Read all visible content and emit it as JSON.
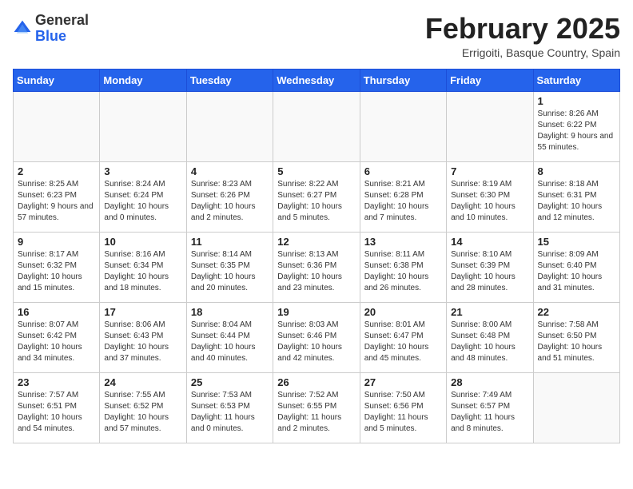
{
  "header": {
    "logo_general": "General",
    "logo_blue": "Blue",
    "title": "February 2025",
    "subtitle": "Errigoiti, Basque Country, Spain"
  },
  "weekdays": [
    "Sunday",
    "Monday",
    "Tuesday",
    "Wednesday",
    "Thursday",
    "Friday",
    "Saturday"
  ],
  "weeks": [
    [
      {
        "day": "",
        "info": ""
      },
      {
        "day": "",
        "info": ""
      },
      {
        "day": "",
        "info": ""
      },
      {
        "day": "",
        "info": ""
      },
      {
        "day": "",
        "info": ""
      },
      {
        "day": "",
        "info": ""
      },
      {
        "day": "1",
        "info": "Sunrise: 8:26 AM\nSunset: 6:22 PM\nDaylight: 9 hours and 55 minutes."
      }
    ],
    [
      {
        "day": "2",
        "info": "Sunrise: 8:25 AM\nSunset: 6:23 PM\nDaylight: 9 hours and 57 minutes."
      },
      {
        "day": "3",
        "info": "Sunrise: 8:24 AM\nSunset: 6:24 PM\nDaylight: 10 hours and 0 minutes."
      },
      {
        "day": "4",
        "info": "Sunrise: 8:23 AM\nSunset: 6:26 PM\nDaylight: 10 hours and 2 minutes."
      },
      {
        "day": "5",
        "info": "Sunrise: 8:22 AM\nSunset: 6:27 PM\nDaylight: 10 hours and 5 minutes."
      },
      {
        "day": "6",
        "info": "Sunrise: 8:21 AM\nSunset: 6:28 PM\nDaylight: 10 hours and 7 minutes."
      },
      {
        "day": "7",
        "info": "Sunrise: 8:19 AM\nSunset: 6:30 PM\nDaylight: 10 hours and 10 minutes."
      },
      {
        "day": "8",
        "info": "Sunrise: 8:18 AM\nSunset: 6:31 PM\nDaylight: 10 hours and 12 minutes."
      }
    ],
    [
      {
        "day": "9",
        "info": "Sunrise: 8:17 AM\nSunset: 6:32 PM\nDaylight: 10 hours and 15 minutes."
      },
      {
        "day": "10",
        "info": "Sunrise: 8:16 AM\nSunset: 6:34 PM\nDaylight: 10 hours and 18 minutes."
      },
      {
        "day": "11",
        "info": "Sunrise: 8:14 AM\nSunset: 6:35 PM\nDaylight: 10 hours and 20 minutes."
      },
      {
        "day": "12",
        "info": "Sunrise: 8:13 AM\nSunset: 6:36 PM\nDaylight: 10 hours and 23 minutes."
      },
      {
        "day": "13",
        "info": "Sunrise: 8:11 AM\nSunset: 6:38 PM\nDaylight: 10 hours and 26 minutes."
      },
      {
        "day": "14",
        "info": "Sunrise: 8:10 AM\nSunset: 6:39 PM\nDaylight: 10 hours and 28 minutes."
      },
      {
        "day": "15",
        "info": "Sunrise: 8:09 AM\nSunset: 6:40 PM\nDaylight: 10 hours and 31 minutes."
      }
    ],
    [
      {
        "day": "16",
        "info": "Sunrise: 8:07 AM\nSunset: 6:42 PM\nDaylight: 10 hours and 34 minutes."
      },
      {
        "day": "17",
        "info": "Sunrise: 8:06 AM\nSunset: 6:43 PM\nDaylight: 10 hours and 37 minutes."
      },
      {
        "day": "18",
        "info": "Sunrise: 8:04 AM\nSunset: 6:44 PM\nDaylight: 10 hours and 40 minutes."
      },
      {
        "day": "19",
        "info": "Sunrise: 8:03 AM\nSunset: 6:46 PM\nDaylight: 10 hours and 42 minutes."
      },
      {
        "day": "20",
        "info": "Sunrise: 8:01 AM\nSunset: 6:47 PM\nDaylight: 10 hours and 45 minutes."
      },
      {
        "day": "21",
        "info": "Sunrise: 8:00 AM\nSunset: 6:48 PM\nDaylight: 10 hours and 48 minutes."
      },
      {
        "day": "22",
        "info": "Sunrise: 7:58 AM\nSunset: 6:50 PM\nDaylight: 10 hours and 51 minutes."
      }
    ],
    [
      {
        "day": "23",
        "info": "Sunrise: 7:57 AM\nSunset: 6:51 PM\nDaylight: 10 hours and 54 minutes."
      },
      {
        "day": "24",
        "info": "Sunrise: 7:55 AM\nSunset: 6:52 PM\nDaylight: 10 hours and 57 minutes."
      },
      {
        "day": "25",
        "info": "Sunrise: 7:53 AM\nSunset: 6:53 PM\nDaylight: 11 hours and 0 minutes."
      },
      {
        "day": "26",
        "info": "Sunrise: 7:52 AM\nSunset: 6:55 PM\nDaylight: 11 hours and 2 minutes."
      },
      {
        "day": "27",
        "info": "Sunrise: 7:50 AM\nSunset: 6:56 PM\nDaylight: 11 hours and 5 minutes."
      },
      {
        "day": "28",
        "info": "Sunrise: 7:49 AM\nSunset: 6:57 PM\nDaylight: 11 hours and 8 minutes."
      },
      {
        "day": "",
        "info": ""
      }
    ]
  ]
}
